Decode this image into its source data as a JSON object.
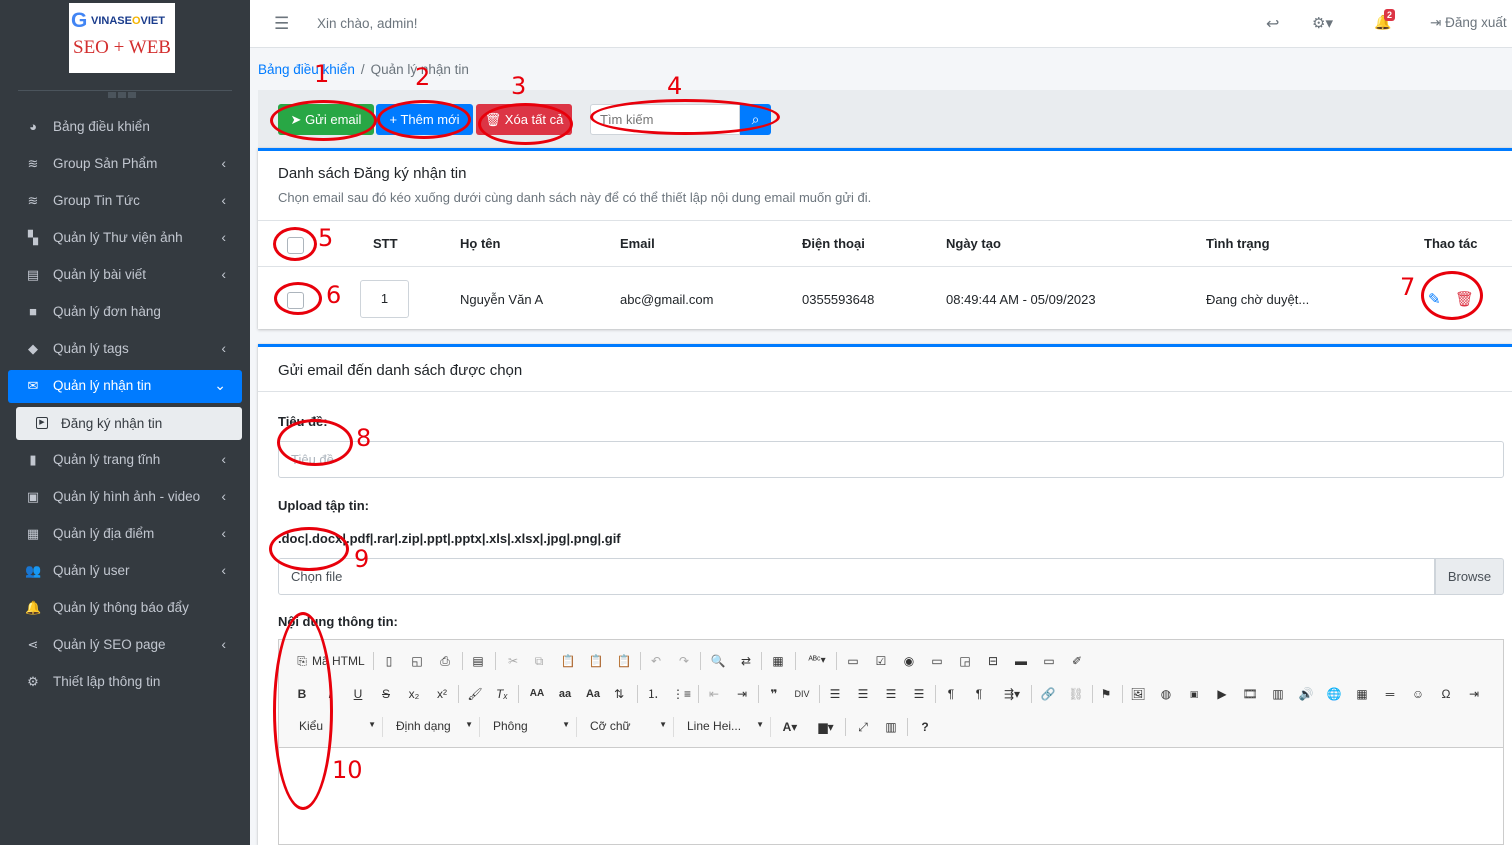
{
  "logo": {
    "brand_prefix": "VINASE",
    "brand_suffix": "VIET",
    "subtitle": "SEO + WEB"
  },
  "sidebar": {
    "items": [
      {
        "icon": "dashboard-icon",
        "label": "Bảng điều khiển"
      },
      {
        "icon": "layers-icon",
        "label": "Group Sản Phẩm"
      },
      {
        "icon": "layers-icon",
        "label": "Group Tin Tức"
      },
      {
        "icon": "gallery-icon",
        "label": "Quản lý Thư viện ảnh"
      },
      {
        "icon": "article-icon",
        "label": "Quản lý bài viết"
      },
      {
        "icon": "bag-icon",
        "label": "Quản lý đơn hàng"
      },
      {
        "icon": "tags-icon",
        "label": "Quản lý tags"
      },
      {
        "icon": "envelope-icon",
        "label": "Quản lý nhận tin"
      },
      {
        "icon": "bookmark-icon",
        "label": "Quản lý trang tĩnh"
      },
      {
        "icon": "photo-video-icon",
        "label": "Quản lý hình ảnh - video"
      },
      {
        "icon": "building-icon",
        "label": "Quản lý địa điểm"
      },
      {
        "icon": "users-icon",
        "label": "Quản lý user"
      },
      {
        "icon": "bell-icon",
        "label": "Quản lý thông báo đẩy"
      },
      {
        "icon": "share-icon",
        "label": "Quản lý SEO page"
      },
      {
        "icon": "settings-icon",
        "label": "Thiết lập thông tin"
      }
    ],
    "sub_item": "Đăng ký nhận tin"
  },
  "topbar": {
    "greeting": "Xin chào, admin!",
    "notification_count": "2",
    "logout": "Đăng xuất"
  },
  "breadcrumb": {
    "home": "Bảng điều khiển",
    "current": "Quản lý nhận tin"
  },
  "toolbar": {
    "send_email": "Gửi email",
    "add_new": "Thêm mới",
    "delete_all": "Xóa tất cả",
    "search_placeholder": "Tìm kiếm"
  },
  "list_card": {
    "title": "Danh sách Đăng ký nhận tin",
    "description": "Chọn email sau đó kéo xuống dưới cùng danh sách này để có thể thiết lập nội dung email muốn gửi đi.",
    "columns": [
      "STT",
      "Họ tên",
      "Email",
      "Điện thoại",
      "Ngày tạo",
      "Tình trạng",
      "Thao tác"
    ],
    "rows": [
      {
        "stt": "1",
        "name": "Nguyễn Văn A",
        "email": "abc@gmail.com",
        "phone": "0355593648",
        "created": "08:49:44 AM - 05/09/2023",
        "status": "Đang chờ duyệt..."
      }
    ]
  },
  "email_card": {
    "title": "Gửi email đến danh sách được chọn",
    "subject_label": "Tiêu đề:",
    "subject_placeholder": "Tiêu đề",
    "upload_label": "Upload tập tin:",
    "allowed_types": ".doc|.docx|.pdf|.rar|.zip|.ppt|.pptx|.xls|.xlsx|.jpg|.png|.gif",
    "file_placeholder": "Chọn file",
    "browse": "Browse",
    "content_label": "Nội dung thông tin:",
    "editor": {
      "source": "Mã HTML",
      "style": "Kiểu",
      "format": "Định dạng",
      "font": "Phông",
      "size": "Cỡ chữ",
      "line_height": "Line Hei..."
    }
  },
  "annotations": [
    "1",
    "2",
    "3",
    "4",
    "5",
    "6",
    "7",
    "8",
    "9",
    "10"
  ],
  "colors": {
    "primary": "#007bff",
    "success": "#28a745",
    "danger": "#dc3545",
    "sidebar": "#343a40",
    "annotation": "#e8000b"
  }
}
